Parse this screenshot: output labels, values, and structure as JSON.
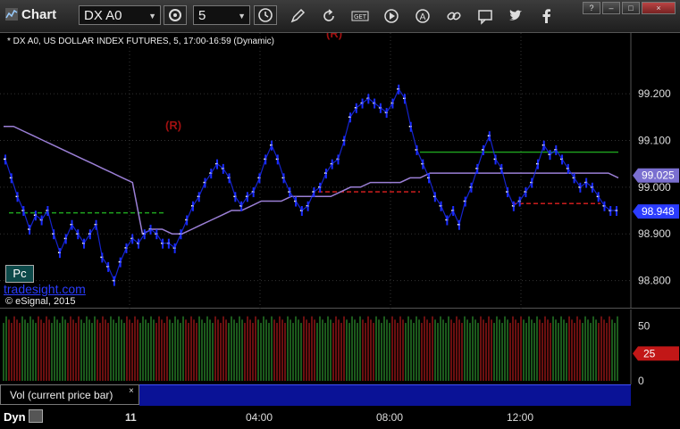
{
  "toolbar": {
    "title": "Chart",
    "symbol": "DX A0",
    "interval": "5",
    "window_buttons": [
      "?",
      "–",
      "□",
      "×"
    ]
  },
  "chart_data": {
    "type": "line",
    "title": "* DX A0, US DOLLAR INDEX FUTURES, 5, 17:00-16:59 (Dynamic)",
    "ylim": [
      98.74,
      99.33
    ],
    "y_ticks": [
      "98.800",
      "98.900",
      "99.000",
      "99.100",
      "99.200"
    ],
    "x_ticks": [
      "11",
      "04:00",
      "08:00",
      "12:00"
    ],
    "price_flags": [
      {
        "label": "99.025",
        "value": 99.025,
        "color": "#7a6fd0"
      },
      {
        "label": "98.948",
        "value": 98.948,
        "color": "#2b3cff"
      }
    ],
    "series": [
      {
        "name": "Price",
        "color": "#1a2cff",
        "values": [
          99.06,
          99.02,
          98.98,
          98.95,
          98.91,
          98.94,
          98.93,
          98.95,
          98.9,
          98.86,
          98.89,
          98.92,
          98.9,
          98.88,
          98.9,
          98.92,
          98.85,
          98.83,
          98.8,
          98.84,
          98.87,
          98.89,
          98.88,
          98.9,
          98.91,
          98.9,
          98.88,
          98.88,
          98.87,
          98.9,
          98.93,
          98.96,
          98.98,
          99.01,
          99.03,
          99.05,
          99.04,
          99.02,
          98.98,
          98.96,
          98.98,
          98.99,
          99.02,
          99.06,
          99.09,
          99.06,
          99.02,
          98.99,
          98.97,
          98.95,
          98.96,
          98.99,
          99.0,
          99.03,
          99.05,
          99.06,
          99.1,
          99.15,
          99.17,
          99.18,
          99.19,
          99.18,
          99.17,
          99.16,
          99.18,
          99.21,
          99.19,
          99.13,
          99.08,
          99.05,
          99.02,
          98.98,
          98.96,
          98.93,
          98.95,
          98.92,
          98.97,
          99.0,
          99.04,
          99.08,
          99.11,
          99.06,
          99.04,
          98.99,
          98.96,
          98.97,
          98.99,
          99.01,
          99.05,
          99.09,
          99.07,
          99.08,
          99.06,
          99.04,
          99.02,
          99.0,
          99.01,
          99.0,
          98.98,
          98.96,
          98.95,
          98.95
        ]
      },
      {
        "name": "MA",
        "color": "#9b7fd6",
        "values": [
          99.13,
          99.13,
          99.12,
          99.11,
          99.1,
          99.09,
          99.08,
          99.07,
          99.06,
          99.05,
          99.04,
          99.03,
          99.02,
          99.01,
          98.9,
          98.91,
          98.91,
          98.9,
          98.9,
          98.91,
          98.92,
          98.93,
          98.94,
          98.95,
          98.95,
          98.96,
          98.97,
          98.97,
          98.97,
          98.98,
          98.98,
          98.98,
          98.98,
          98.98,
          98.99,
          99.0,
          99.0,
          99.01,
          99.01,
          99.01,
          99.01,
          99.02,
          99.02,
          99.03,
          99.03,
          99.03,
          99.03,
          99.03,
          99.03,
          99.03,
          99.03,
          99.03,
          99.03,
          99.03,
          99.03,
          99.03,
          99.03,
          99.03,
          99.03,
          99.03,
          99.03,
          99.03,
          99.02
        ]
      }
    ],
    "levels": [
      {
        "value": 98.945,
        "color": "#1fa51f",
        "style": "dashed"
      },
      {
        "value": 99.075,
        "color": "#1fa51f",
        "style": "solid"
      },
      {
        "value": 98.99,
        "color": "#e02020",
        "style": "dashed"
      },
      {
        "value": 98.965,
        "color": "#e02020",
        "style": "dashed"
      }
    ],
    "annotations": [
      {
        "text": "(R)",
        "color": "#a01010"
      },
      {
        "text": "(R)",
        "color": "#a01010"
      },
      {
        "text": "Pc",
        "color": "#ffffff"
      }
    ],
    "volume": {
      "label": "Vol (current price bar)",
      "ylim": [
        0,
        62
      ],
      "y_ticks": [
        "0",
        "25",
        "50"
      ],
      "last_value": "25"
    }
  },
  "overlay": {
    "copyright": "© eSignal, 2015",
    "watermark": "tradesight.com",
    "pc_label": "Pc",
    "dyn_label": "Dyn"
  }
}
